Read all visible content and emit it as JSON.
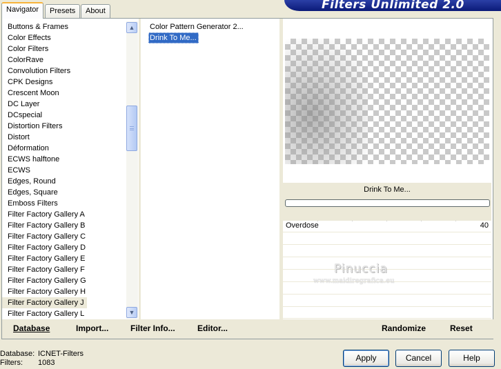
{
  "tabs": [
    {
      "label": "Navigator",
      "active": true
    },
    {
      "label": "Presets",
      "active": false
    },
    {
      "label": "About",
      "active": false
    }
  ],
  "banner_title": "Filters Unlimited 2.0",
  "categories": [
    "Buttons & Frames",
    "Color Effects",
    "Color Filters",
    "ColorRave",
    "Convolution Filters",
    "CPK Designs",
    "Crescent Moon",
    "DC Layer",
    "DCspecial",
    "Distortion Filters",
    "Distort",
    "Déformation",
    "ECWS halftone",
    "ECWS",
    "Edges, Round",
    "Edges, Square",
    "Emboss Filters",
    "Filter Factory Gallery A",
    "Filter Factory Gallery B",
    "Filter Factory Gallery C",
    "Filter Factory Gallery D",
    "Filter Factory Gallery E",
    "Filter Factory Gallery F",
    "Filter Factory Gallery G",
    "Filter Factory Gallery H",
    "Filter Factory Gallery J",
    "Filter Factory Gallery L"
  ],
  "selected_category": "Filter Factory Gallery J",
  "filters": [
    "Color Pattern Generator 2...",
    "Drink To Me..."
  ],
  "selected_filter": "Drink To Me...",
  "preview_filter_name": "Drink To Me...",
  "parameters": [
    {
      "name": "Overdose",
      "value": "40",
      "fraction": 0.157
    }
  ],
  "watermark": {
    "line1": "Pinuccia",
    "line2": "www.maidiregrafica.eu"
  },
  "bottom_links": {
    "database": "Database",
    "import": "Import...",
    "filter_info": "Filter Info...",
    "editor": "Editor...",
    "randomize": "Randomize",
    "reset": "Reset"
  },
  "status": {
    "database_label": "Database:",
    "database_value": "ICNET-Filters",
    "filters_label": "Filters:",
    "filters_value": "1083"
  },
  "buttons": {
    "apply": "Apply",
    "cancel": "Cancel",
    "help": "Help"
  },
  "colors": {
    "selection": "#316ac5",
    "banner": "#0b1a78",
    "dialog_bg": "#ece9d8"
  }
}
